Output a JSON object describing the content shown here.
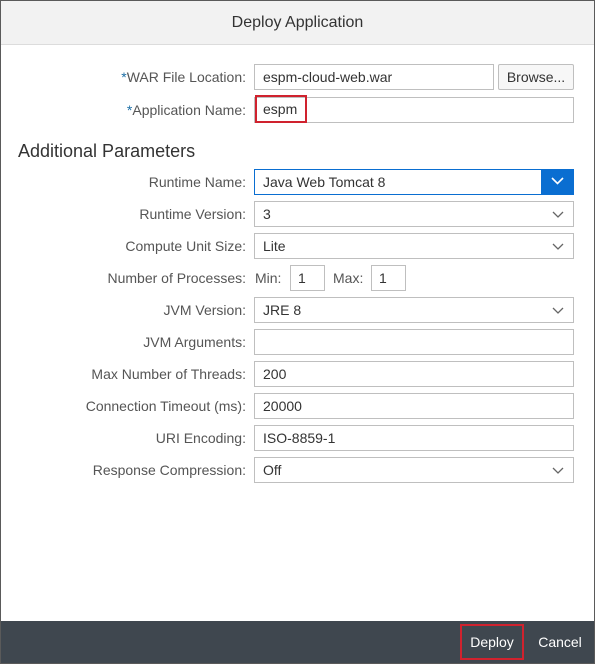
{
  "dialog": {
    "title": "Deploy Application"
  },
  "war_file": {
    "label": "WAR File Location:",
    "value": "espm-cloud-web.war",
    "browse_label": "Browse..."
  },
  "app_name": {
    "label": "Application Name:",
    "value": "espm"
  },
  "required_marker": "*",
  "section": {
    "title": "Additional Parameters"
  },
  "runtime_name": {
    "label": "Runtime Name:",
    "value": "Java Web Tomcat 8"
  },
  "runtime_version": {
    "label": "Runtime Version:",
    "value": "3"
  },
  "compute_unit": {
    "label": "Compute Unit Size:",
    "value": "Lite"
  },
  "processes": {
    "label": "Number of Processes:",
    "min_label": "Min:",
    "min_value": "1",
    "max_label": "Max:",
    "max_value": "1"
  },
  "jvm_version": {
    "label": "JVM Version:",
    "value": "JRE 8"
  },
  "jvm_args": {
    "label": "JVM Arguments:",
    "value": ""
  },
  "max_threads": {
    "label": "Max Number of Threads:",
    "value": "200"
  },
  "conn_timeout": {
    "label": "Connection Timeout (ms):",
    "value": "20000"
  },
  "uri_encoding": {
    "label": "URI Encoding:",
    "value": "ISO-8859-1"
  },
  "response_compression": {
    "label": "Response Compression:",
    "value": "Off"
  },
  "footer": {
    "deploy_label": "Deploy",
    "cancel_label": "Cancel"
  },
  "colors": {
    "accent": "#0a6ed1",
    "highlight": "#d0222e",
    "footer_bg": "#3f474f",
    "required": "#1d6fa6"
  }
}
